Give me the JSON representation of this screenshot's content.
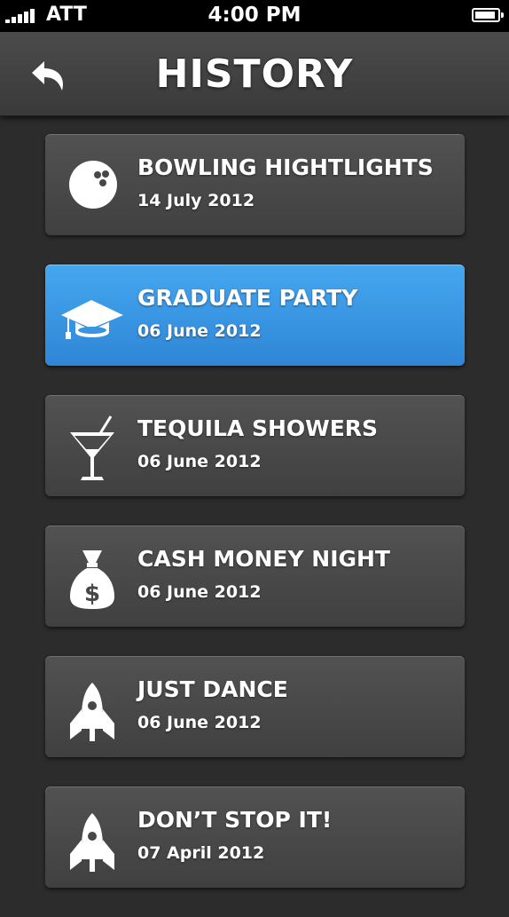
{
  "status_bar": {
    "carrier": "ATT",
    "time": "4:00 PM"
  },
  "header": {
    "title": "HISTORY",
    "back_icon": "back-arrow-icon"
  },
  "accent_color": "#3a97e4",
  "history": [
    {
      "title": "BOWLING HIGHTLIGHTS",
      "date": "14 July 2012",
      "icon": "bowling-ball-icon",
      "selected": false
    },
    {
      "title": "GRADUATE PARTY",
      "date": "06 June 2012",
      "icon": "graduation-cap-icon",
      "selected": true
    },
    {
      "title": "TEQUILA SHOWERS",
      "date": "06 June 2012",
      "icon": "cocktail-glass-icon",
      "selected": false
    },
    {
      "title": "CASH MONEY NIGHT",
      "date": "06 June 2012",
      "icon": "money-bag-icon",
      "selected": false
    },
    {
      "title": "JUST DANCE",
      "date": "06 June 2012",
      "icon": "rocket-icon",
      "selected": false
    },
    {
      "title": "DON’T STOP IT!",
      "date": "07 April 2012",
      "icon": "rocket-icon",
      "selected": false
    }
  ]
}
